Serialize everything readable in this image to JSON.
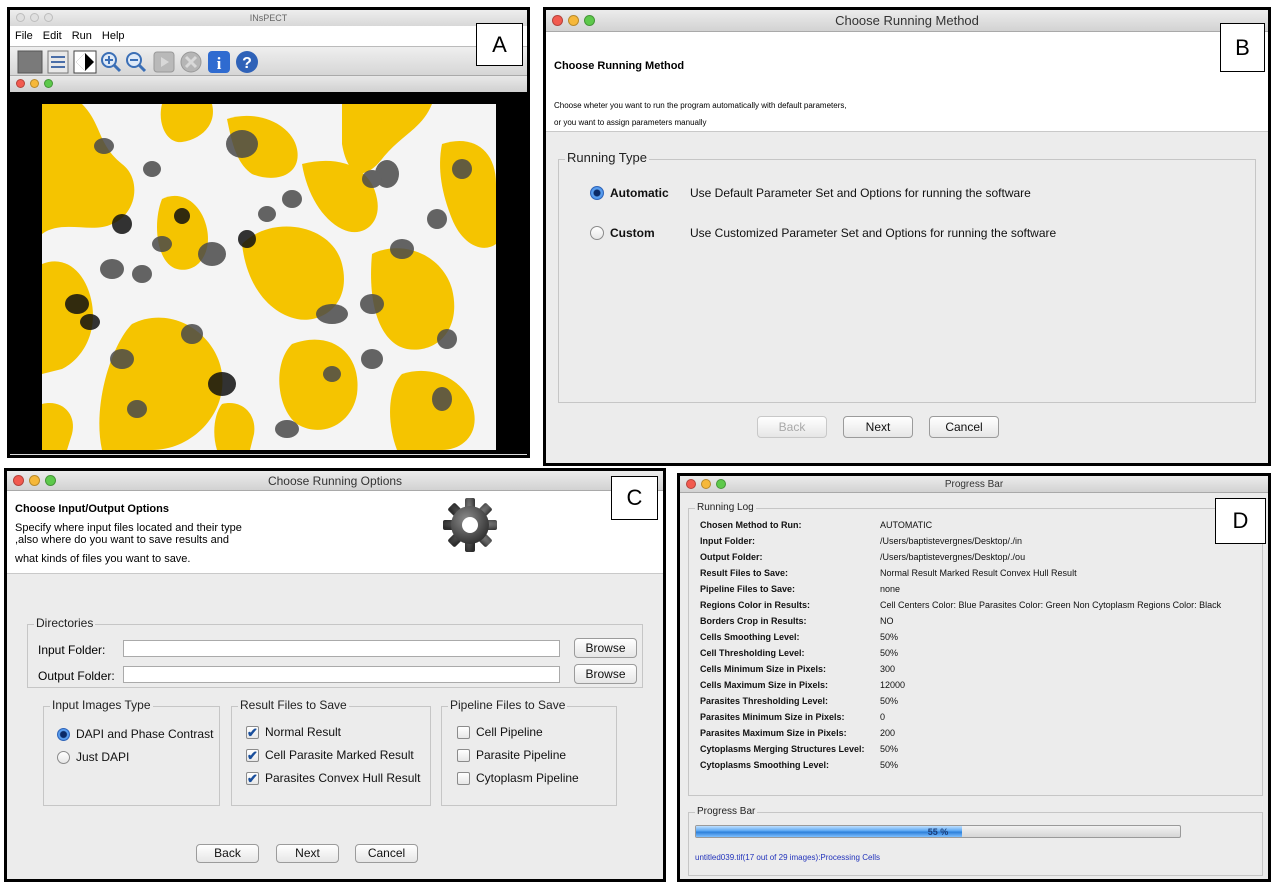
{
  "panel_a": {
    "letter": "A",
    "window_title": "INsPECT",
    "menu": [
      "File",
      "Edit",
      "Run",
      "Help"
    ],
    "toolbar_icons": [
      "open-icon",
      "list-icon",
      "contrast-icon",
      "zoom-in-icon",
      "zoom-out-icon",
      "run-icon",
      "stop-icon",
      "info-icon",
      "help-icon"
    ]
  },
  "panel_b": {
    "letter": "B",
    "window_title": "Choose Running Method",
    "heading": "Choose Running Method",
    "description_line1": "Choose wheter you want to run the program automatically with default parameters,",
    "description_line2": "or you want to assign parameters manually",
    "group_title": "Running Type",
    "options": [
      {
        "label": "Automatic",
        "description": "Use Default Parameter Set and Options for running the software",
        "selected": true
      },
      {
        "label": "Custom",
        "description": "Use Customized Parameter Set and Options for running the software",
        "selected": false
      }
    ],
    "back_label": "Back",
    "next_label": "Next",
    "cancel_label": "Cancel"
  },
  "panel_c": {
    "letter": "C",
    "window_title": "Choose Running Options",
    "heading": "Choose Input/Output Options",
    "description_line1": "Specify where input files located and their type",
    "description_line2": ",also where do you want to save results and",
    "description_line3": "what kinds of files you want to save.",
    "directories_title": "Directories",
    "input_folder_label": "Input Folder:",
    "output_folder_label": "Output Folder:",
    "browse_label": "Browse",
    "input_type_title": "Input Images Type",
    "input_types": [
      {
        "label": "DAPI and Phase Contrast",
        "selected": true
      },
      {
        "label": "Just DAPI",
        "selected": false
      }
    ],
    "result_title": "Result Files to Save",
    "result_files": [
      {
        "label": "Normal Result",
        "checked": true
      },
      {
        "label": "Cell Parasite Marked Result",
        "checked": true
      },
      {
        "label": "Parasites Convex Hull Result",
        "checked": true
      }
    ],
    "pipeline_title": "Pipeline Files to Save",
    "pipeline_files": [
      {
        "label": "Cell Pipeline",
        "checked": false
      },
      {
        "label": "Parasite Pipeline",
        "checked": false
      },
      {
        "label": "Cytoplasm Pipeline",
        "checked": false
      }
    ],
    "back_label": "Back",
    "next_label": "Next",
    "cancel_label": "Cancel"
  },
  "panel_d": {
    "letter": "D",
    "window_title": "Progress Bar",
    "log_title": "Running Log",
    "log": [
      {
        "key": "Chosen Method to Run:",
        "value": "AUTOMATIC"
      },
      {
        "key": "Input Folder:",
        "value": "/Users/baptistevergnes/Desktop/./in"
      },
      {
        "key": "Output Folder:",
        "value": "/Users/baptistevergnes/Desktop/./ou"
      },
      {
        "key": "Result Files to Save:",
        "value": "Normal Result Marked Result Convex Hull Result"
      },
      {
        "key": "Pipeline Files to Save:",
        "value": "none"
      },
      {
        "key": "Regions Color in Results:",
        "value": "Cell Centers Color: Blue Parasites Color: Green Non Cytoplasm Regions Color: Black"
      },
      {
        "key": "Borders Crop in Results:",
        "value": "NO"
      },
      {
        "key": "Cells Smoothing Level:",
        "value": "50%"
      },
      {
        "key": "Cell Thresholding Level:",
        "value": "50%"
      },
      {
        "key": "Cells Minimum Size in Pixels:",
        "value": "300"
      },
      {
        "key": "Cells Maximum Size in Pixels:",
        "value": "12000"
      },
      {
        "key": "Parasites Thresholding Level:",
        "value": "50%"
      },
      {
        "key": "Parasites Minimum Size in Pixels:",
        "value": "0"
      },
      {
        "key": "Parasites Maximum Size in Pixels:",
        "value": "200"
      },
      {
        "key": "Cytoplasms Merging Structures Level:",
        "value": "50%"
      },
      {
        "key": "Cytoplasms Smoothing Level:",
        "value": "50%"
      }
    ],
    "progress_title": "Progress Bar",
    "progress_percent": 55,
    "progress_text": "55 %",
    "status_text": "untitled039.tif(17 out of 29 images):Processing Cells"
  },
  "colors": {
    "cytoplasm_yellow": "#f5c400",
    "mac_window_bg": "#ececec",
    "accent_blue": "#3b7fe0"
  }
}
